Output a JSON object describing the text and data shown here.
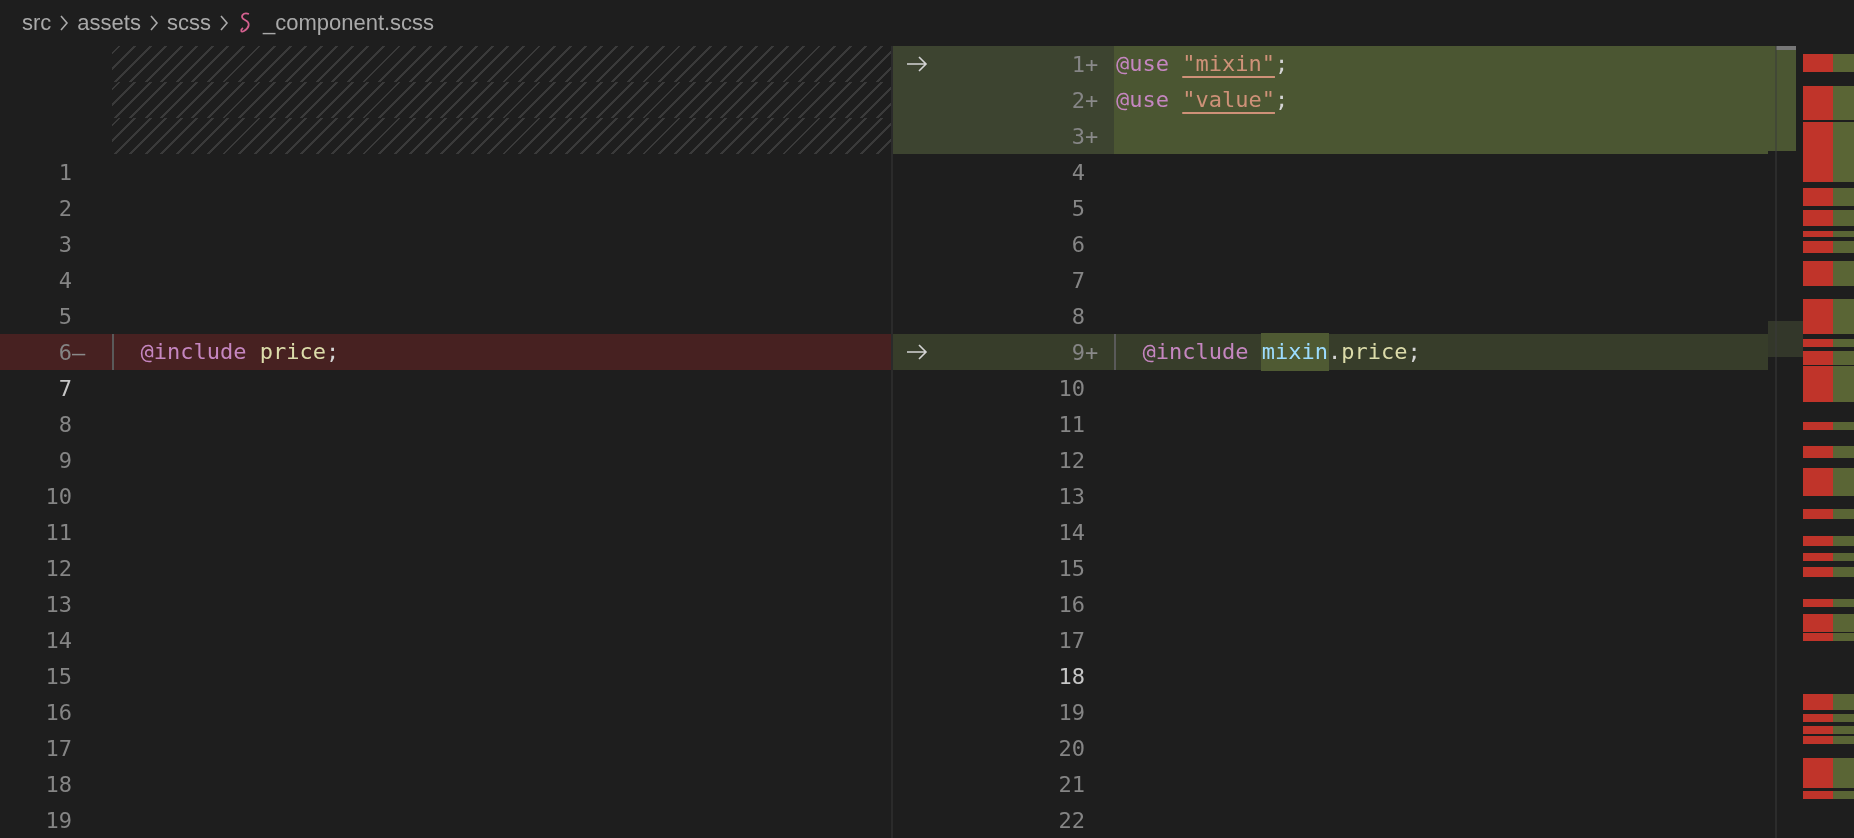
{
  "breadcrumb": [
    {
      "label": "src",
      "kind": "folder"
    },
    {
      "label": "assets",
      "kind": "folder"
    },
    {
      "label": "scss",
      "kind": "folder"
    },
    {
      "label": "_component.scss",
      "kind": "sass-file"
    }
  ],
  "left_pane": {
    "lines": [
      {
        "kind": "filler"
      },
      {
        "kind": "filler"
      },
      {
        "kind": "filler"
      },
      {
        "kind": "normal",
        "number": "1",
        "active": false
      },
      {
        "kind": "normal",
        "number": "2",
        "active": false
      },
      {
        "kind": "normal",
        "number": "3",
        "active": false
      },
      {
        "kind": "normal",
        "number": "4",
        "active": false
      },
      {
        "kind": "normal",
        "number": "5",
        "active": false
      },
      {
        "kind": "removed",
        "number": "6",
        "sign": "—",
        "active": false,
        "tokens": [
          {
            "text": "  @include ",
            "kind": "keyword",
            "changed": false
          },
          {
            "text": "price",
            "kind": "function",
            "changed": false
          },
          {
            "text": ";",
            "kind": "punct",
            "changed": false
          }
        ]
      },
      {
        "kind": "normal",
        "number": "7",
        "active": true
      },
      {
        "kind": "normal",
        "number": "8",
        "active": false
      },
      {
        "kind": "normal",
        "number": "9",
        "active": false
      },
      {
        "kind": "normal",
        "number": "10",
        "active": false
      },
      {
        "kind": "normal",
        "number": "11",
        "active": false
      },
      {
        "kind": "normal",
        "number": "12",
        "active": false
      },
      {
        "kind": "normal",
        "number": "13",
        "active": false
      },
      {
        "kind": "normal",
        "number": "14",
        "active": false
      },
      {
        "kind": "normal",
        "number": "15",
        "active": false
      },
      {
        "kind": "normal",
        "number": "16",
        "active": false
      },
      {
        "kind": "normal",
        "number": "17",
        "active": false
      },
      {
        "kind": "normal",
        "number": "18",
        "active": false
      },
      {
        "kind": "normal",
        "number": "19",
        "active": false
      }
    ]
  },
  "right_pane": {
    "lines": [
      {
        "kind": "added",
        "number": "1",
        "sign": "+",
        "arrow": true,
        "active": false,
        "tokens": [
          {
            "text": "@use ",
            "kind": "keyword"
          },
          {
            "text": "\"mixin\"",
            "kind": "string"
          },
          {
            "text": ";",
            "kind": "punct"
          }
        ]
      },
      {
        "kind": "added",
        "number": "2",
        "sign": "+",
        "arrow": false,
        "active": false,
        "tokens": [
          {
            "text": "@use ",
            "kind": "keyword"
          },
          {
            "text": "\"value\"",
            "kind": "string"
          },
          {
            "text": ";",
            "kind": "punct"
          }
        ]
      },
      {
        "kind": "added",
        "number": "3",
        "sign": "+",
        "arrow": false,
        "active": false
      },
      {
        "kind": "normal",
        "number": "4",
        "arrow": false,
        "active": false
      },
      {
        "kind": "normal",
        "number": "5",
        "arrow": false,
        "active": false
      },
      {
        "kind": "normal",
        "number": "6",
        "arrow": false,
        "active": false
      },
      {
        "kind": "normal",
        "number": "7",
        "arrow": false,
        "active": false
      },
      {
        "kind": "normal",
        "number": "8",
        "arrow": false,
        "active": false
      },
      {
        "kind": "modified",
        "number": "9",
        "sign": "+",
        "arrow": true,
        "active": false,
        "tokens": [
          {
            "text": "  @include ",
            "kind": "keyword",
            "changed": false
          },
          {
            "text": "mixin",
            "kind": "variable",
            "changed": true
          },
          {
            "text": ".",
            "kind": "punct",
            "changed": false
          },
          {
            "text": "price",
            "kind": "function",
            "changed": false
          },
          {
            "text": ";",
            "kind": "punct",
            "changed": false
          }
        ]
      },
      {
        "kind": "normal",
        "number": "10",
        "arrow": false,
        "active": false
      },
      {
        "kind": "normal",
        "number": "11",
        "arrow": false,
        "active": false
      },
      {
        "kind": "normal",
        "number": "12",
        "arrow": false,
        "active": false
      },
      {
        "kind": "normal",
        "number": "13",
        "arrow": false,
        "active": false
      },
      {
        "kind": "normal",
        "number": "14",
        "arrow": false,
        "active": false
      },
      {
        "kind": "normal",
        "number": "15",
        "arrow": false,
        "active": false
      },
      {
        "kind": "normal",
        "number": "16",
        "arrow": false,
        "active": false
      },
      {
        "kind": "normal",
        "number": "17",
        "arrow": false,
        "active": false
      },
      {
        "kind": "normal",
        "number": "18",
        "arrow": false,
        "active": true
      },
      {
        "kind": "normal",
        "number": "19",
        "arrow": false,
        "active": false
      },
      {
        "kind": "normal",
        "number": "20",
        "arrow": false,
        "active": false
      },
      {
        "kind": "normal",
        "number": "21",
        "arrow": false,
        "active": false
      },
      {
        "kind": "normal",
        "number": "22",
        "arrow": false,
        "active": false
      }
    ]
  }
}
